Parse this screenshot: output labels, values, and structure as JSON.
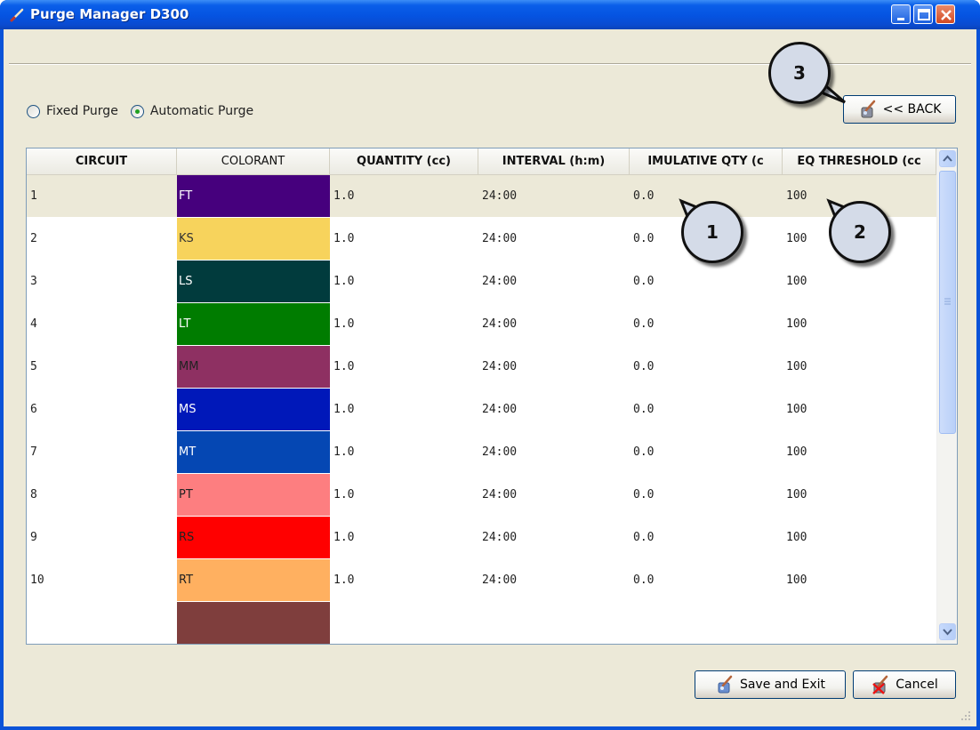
{
  "window": {
    "title": "Purge Manager D300"
  },
  "purge_mode": {
    "options": [
      {
        "label": "Fixed Purge",
        "selected": false
      },
      {
        "label": "Automatic Purge",
        "selected": true
      }
    ]
  },
  "back_button": {
    "label": "<< BACK"
  },
  "table": {
    "headers": [
      "CIRCUIT",
      "COLORANT",
      "QUANTITY (cc)",
      "INTERVAL (h:m)",
      "IMULATIVE QTY (c",
      "EQ THRESHOLD (cc"
    ],
    "rows": [
      {
        "circuit": "1",
        "colorant": "FT",
        "color": "#46007d",
        "quantity": "1.0",
        "interval": "24:00",
        "cumulative": "0.0",
        "threshold": "100",
        "selected": true
      },
      {
        "circuit": "2",
        "colorant": "KS",
        "color": "#f7d35c",
        "quantity": "1.0",
        "interval": "24:00",
        "cumulative": "0.0",
        "threshold": "100",
        "text_color": "#333"
      },
      {
        "circuit": "3",
        "colorant": "LS",
        "color": "#013b3d",
        "quantity": "1.0",
        "interval": "24:00",
        "cumulative": "0.0",
        "threshold": "100"
      },
      {
        "circuit": "4",
        "colorant": "LT",
        "color": "#007c00",
        "quantity": "1.0",
        "interval": "24:00",
        "cumulative": "0.0",
        "threshold": "100"
      },
      {
        "circuit": "5",
        "colorant": "MM",
        "color": "#8e3062",
        "quantity": "1.0",
        "interval": "24:00",
        "cumulative": "0.0",
        "threshold": "100",
        "text_color": "#222"
      },
      {
        "circuit": "6",
        "colorant": "MS",
        "color": "#0018b9",
        "quantity": "1.0",
        "interval": "24:00",
        "cumulative": "0.0",
        "threshold": "100"
      },
      {
        "circuit": "7",
        "colorant": "MT",
        "color": "#0547b3",
        "quantity": "1.0",
        "interval": "24:00",
        "cumulative": "0.0",
        "threshold": "100"
      },
      {
        "circuit": "8",
        "colorant": "PT",
        "color": "#fd7e80",
        "quantity": "1.0",
        "interval": "24:00",
        "cumulative": "0.0",
        "threshold": "100",
        "text_color": "#222"
      },
      {
        "circuit": "9",
        "colorant": "RS",
        "color": "#ff0000",
        "quantity": "1.0",
        "interval": "24:00",
        "cumulative": "0.0",
        "threshold": "100",
        "text_color": "#222"
      },
      {
        "circuit": "10",
        "colorant": "RT",
        "color": "#ffb060",
        "quantity": "1.0",
        "interval": "24:00",
        "cumulative": "0.0",
        "threshold": "100",
        "text_color": "#222"
      },
      {
        "circuit": "",
        "colorant": "",
        "color": "#7f3e3d",
        "quantity": "",
        "interval": "",
        "cumulative": "",
        "threshold": ""
      }
    ]
  },
  "footer": {
    "save_label": "Save and Exit",
    "cancel_label": "Cancel"
  },
  "callouts": [
    "1",
    "2",
    "3"
  ],
  "colors": {
    "titlebar": "#0553e1",
    "client_bg": "#ece9d8",
    "selected_row": "#ece9d8"
  }
}
